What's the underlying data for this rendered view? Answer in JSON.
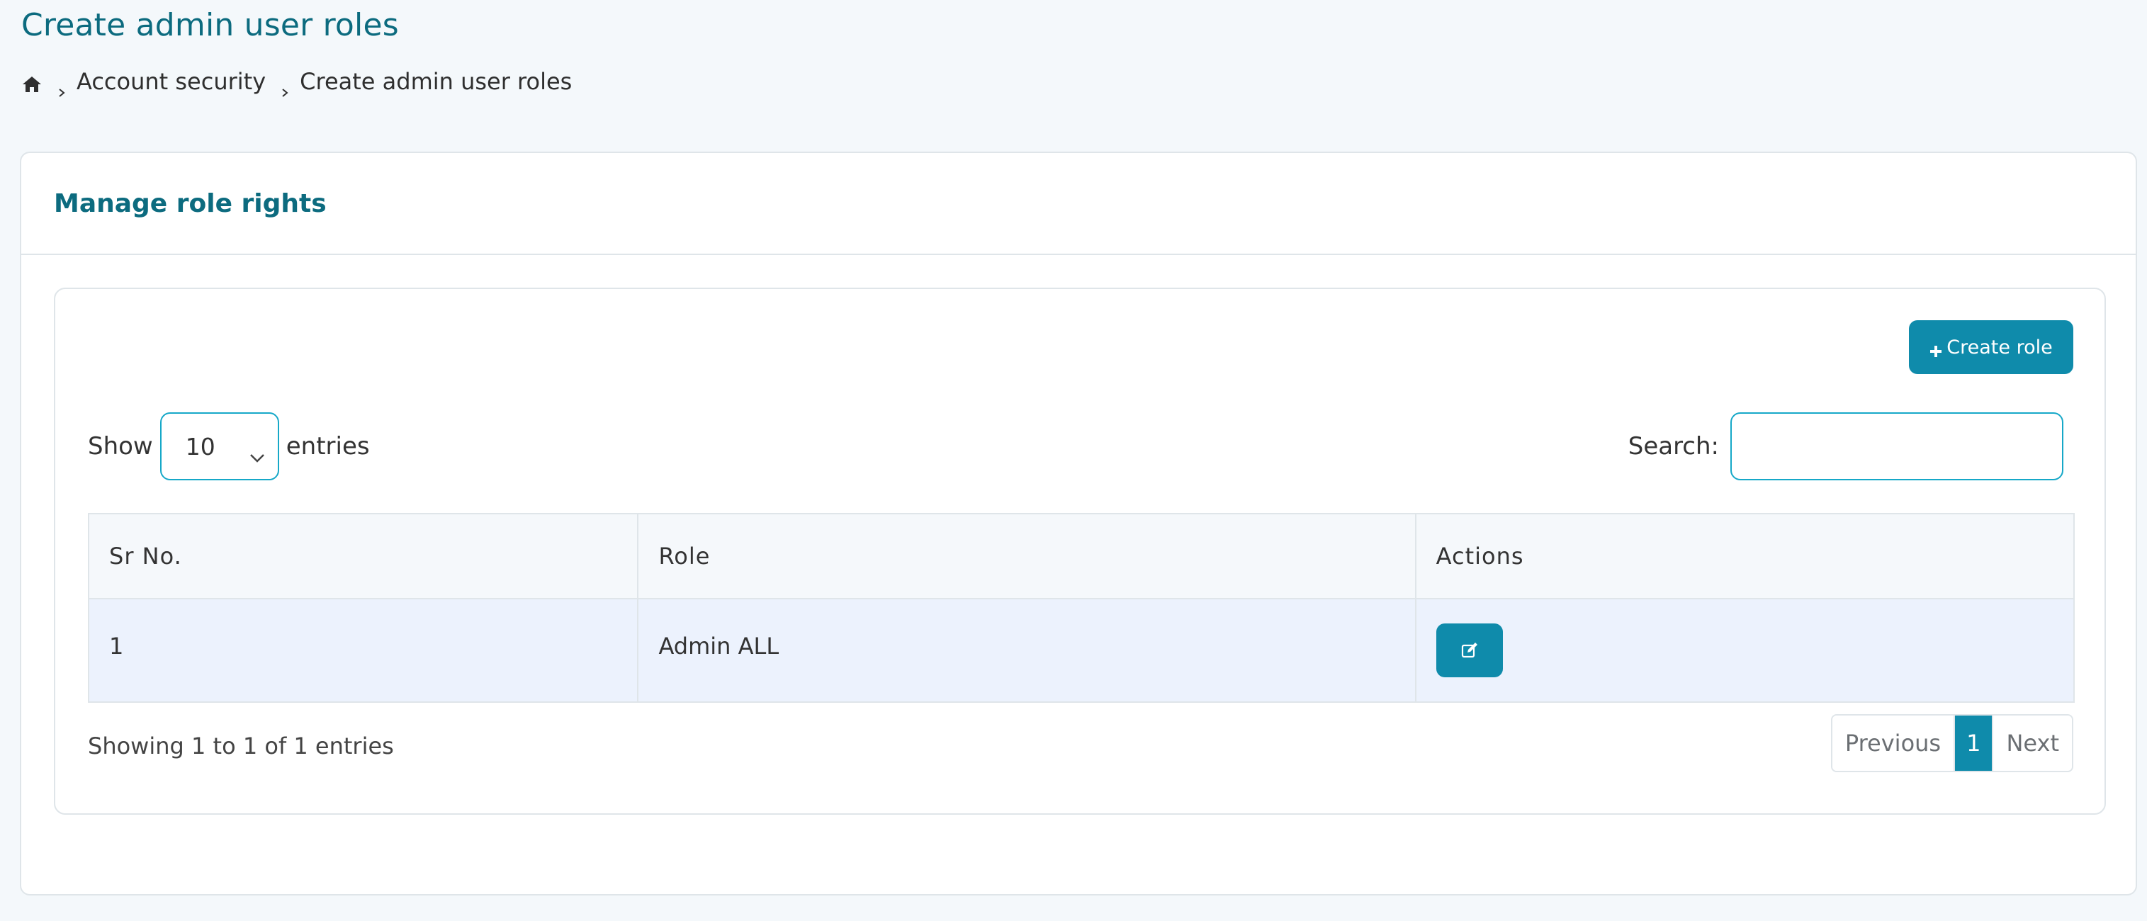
{
  "header": {
    "title": "Create admin user roles",
    "breadcrumb": {
      "home_icon": "home-icon",
      "items": [
        "Account security",
        "Create admin user roles"
      ]
    }
  },
  "card": {
    "title": "Manage role rights",
    "create_button_label": "Create role",
    "length": {
      "label_before": "Show",
      "selected": "10",
      "label_after": "entries"
    },
    "search": {
      "label": "Search:",
      "value": ""
    },
    "table": {
      "columns": [
        "Sr No.",
        "Role",
        "Actions"
      ],
      "rows": [
        {
          "sr_no": "1",
          "role": "Admin ALL",
          "action_icon": "edit-icon"
        }
      ]
    },
    "info": "Showing 1 to 1 of 1 entries",
    "pagination": {
      "previous": "Previous",
      "current": "1",
      "next": "Next"
    }
  },
  "colors": {
    "accent": "#0f8bab",
    "title": "#0c6b7f",
    "row_bg": "#ecf2fd",
    "border": "#dfe5e9"
  }
}
